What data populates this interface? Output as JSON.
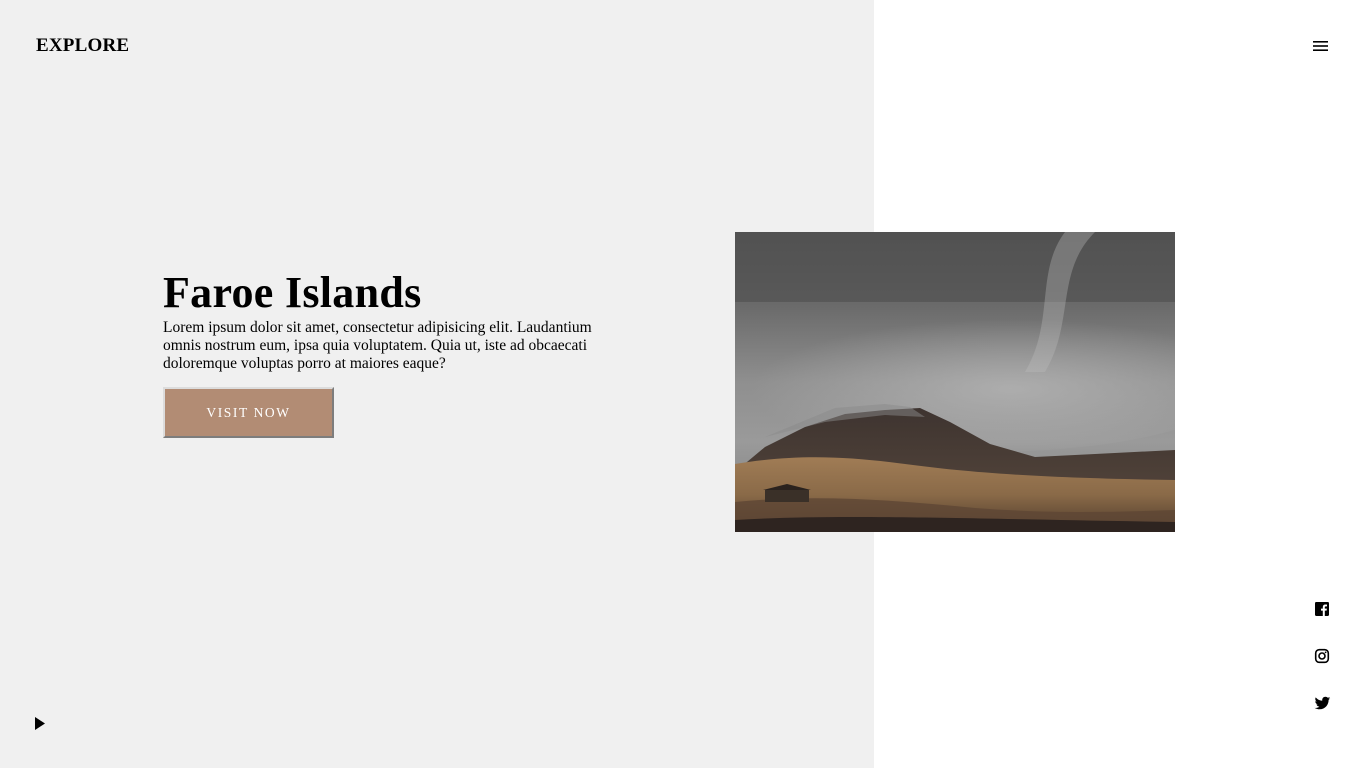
{
  "header": {
    "logo": "EXPLORE",
    "menu_icon": "hamburger-menu-icon"
  },
  "hero": {
    "title": "Faroe Islands",
    "description": "Lorem ipsum dolor sit amet, consectetur adipisicing elit. Laudantium omnis nostrum eum, ipsa quia voluptatem. Quia ut, iste ad obcaecati doloremque voluptas porro at maiores eaque?",
    "cta_label": "VISIT NOW",
    "cta_color": "#b28c74"
  },
  "media": {
    "play_icon": "play-icon"
  },
  "social": [
    {
      "icon": "facebook-icon"
    },
    {
      "icon": "instagram-icon"
    },
    {
      "icon": "twitter-icon"
    }
  ],
  "colors": {
    "left_background": "#f0f0f0",
    "right_background": "#ffffff",
    "text": "#000000"
  }
}
